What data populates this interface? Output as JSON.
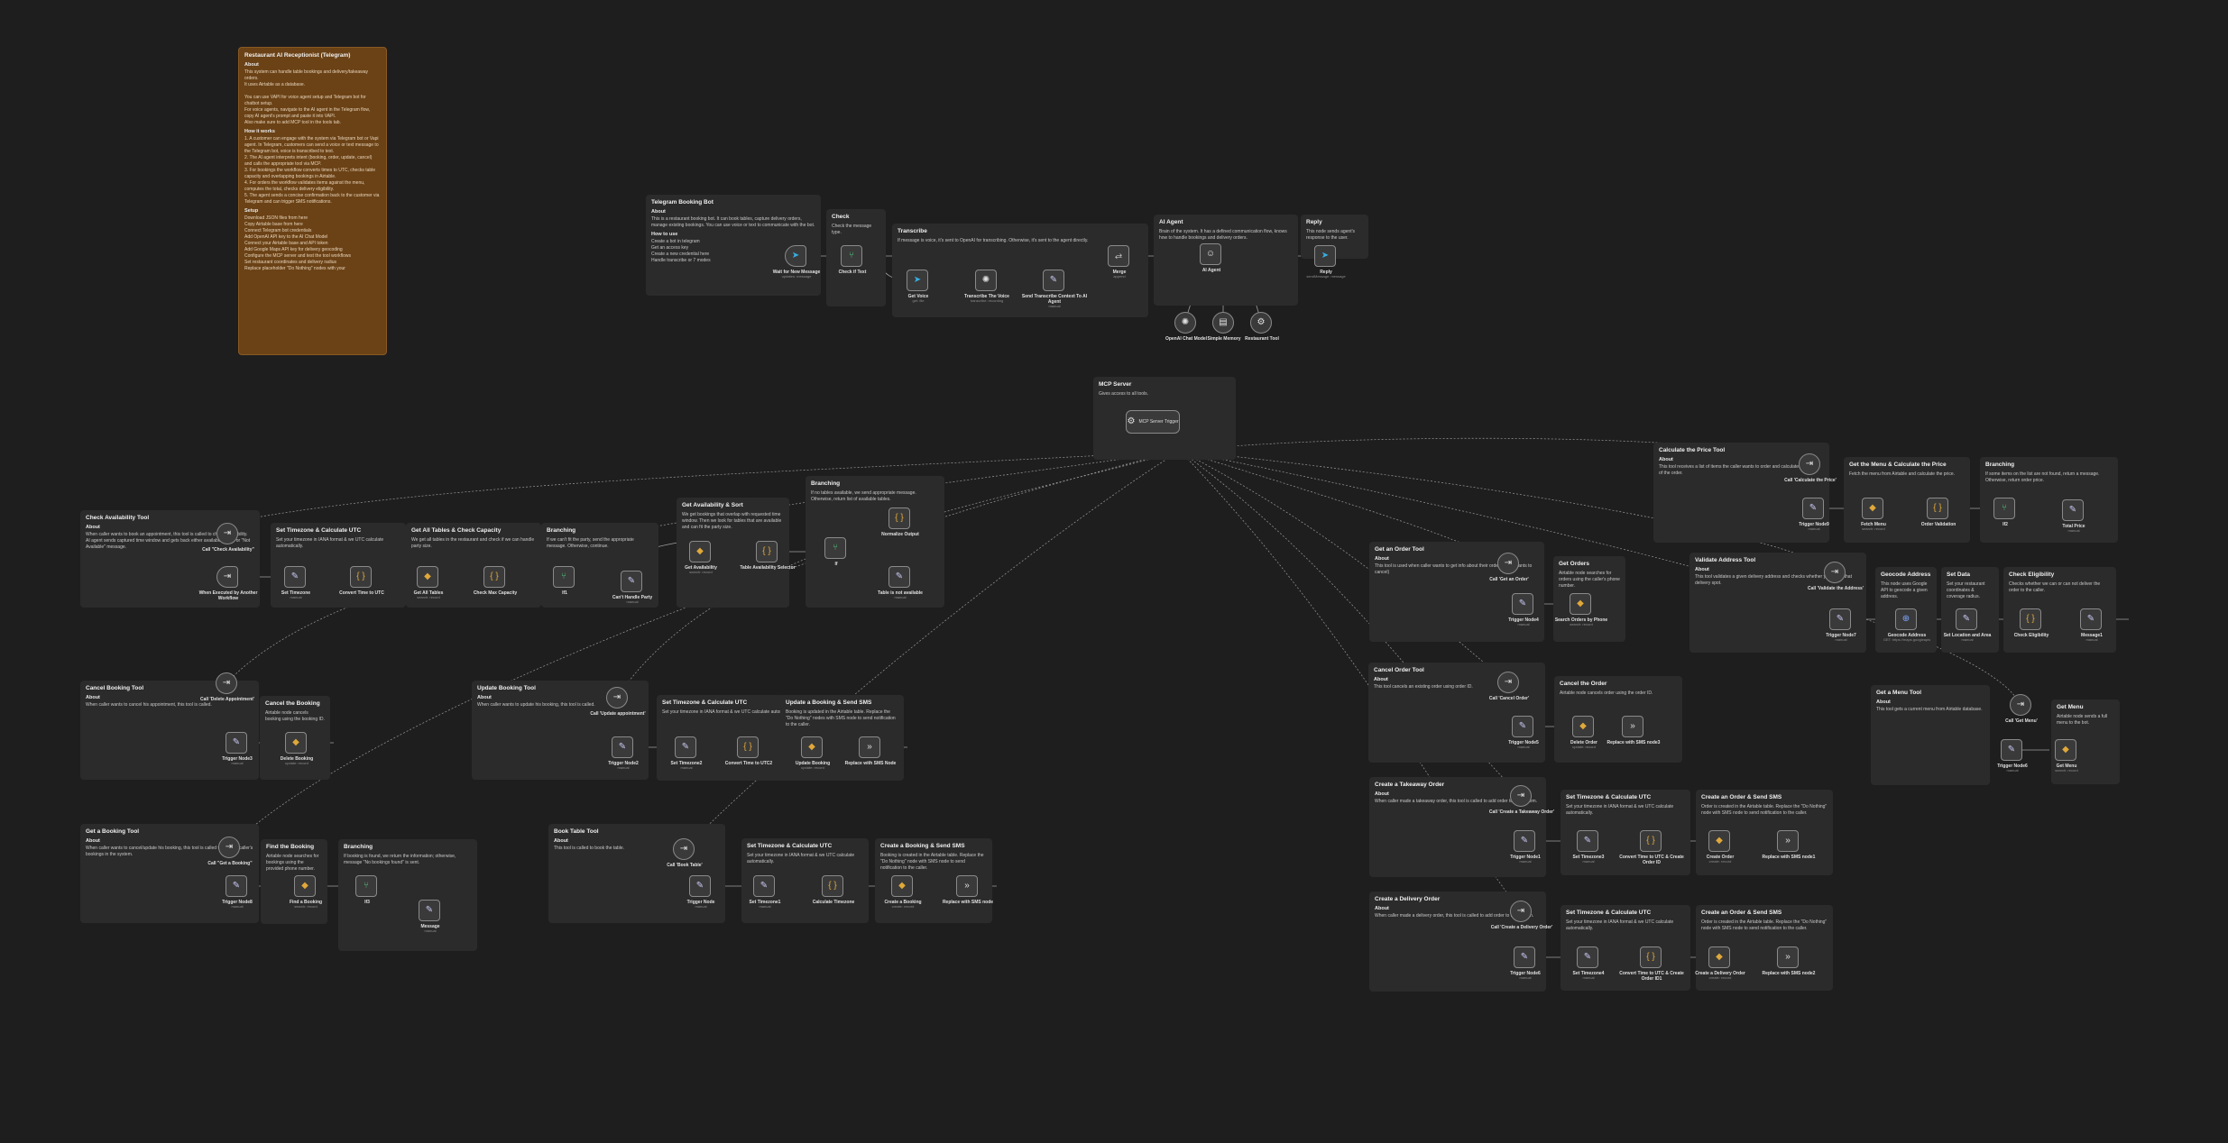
{
  "colors": {
    "canvas": "#1e1e1e",
    "sticky": "#2b2b2b",
    "sticky_intro": "#6b4216",
    "wire": "#9a9a9a",
    "accent": "#ff6d5a"
  },
  "intro": {
    "title": "Restaurant AI Receptionist (Telegram)",
    "about_h": "About",
    "about": "This system can handle table bookings and delivery/takeaway orders.\nIt uses Airtable as a database.\n\nYou can use VAPI for voice agent setup and Telegram bot for chatbot setup.\nFor voice agents, navigate to the AI agent in the Telegram flow, copy AI agent's prompt and paste it into VAPI.\nAlso make sure to add MCP tool in the tools tab.",
    "how_h": "How it works",
    "how": "1. A customer can engage with the system via Telegram bot or Vapi agent. In Telegram, customers can send a voice or text message to the Telegram bot, voice is transcribed to text.\n2. The AI agent interprets intent (booking, order, update, cancel) and calls the appropriate tool via MCP.\n3. For bookings the workflow converts times to UTC, checks table capacity and overlapping bookings in Airtable.\n4. For orders the workflow validates items against the menu, computes the total, checks delivery eligibility.\n5. The agent sends a concise confirmation back to the customer via Telegram and can trigger SMS notifications.",
    "setup_h": "Setup",
    "setup": "Download JSON files from here\nCopy Airtable base from here\nConnect Telegram bot credentials\nAdd OpenAI API key to the AI Chat Model\nConnect your Airtable base and API token\nAdd Google Maps API key for delivery geocoding\nConfigure the MCP server and test the tool workflows\nSet restaurant coordinates and delivery radius\nReplace placeholder \"Do Nothing\" nodes with your"
  },
  "sections": [
    {
      "title": "Telegram Booking Bot",
      "h": "About",
      "body": "This is a restaurant booking bot. It can book tables, capture delivery orders, manage existing bookings. You can use voice or text to communicate with the bot.",
      "h2": "How to use",
      "body2": "Create a bot in telegram\nGet an access key\nCreate a new credential here\nHandle transcribe or 7 modes"
    },
    {
      "title": "Check",
      "body": "Check the message type."
    },
    {
      "title": "Transcribe",
      "body": "If message is voice, it's sent to OpenAI for transcribing. Otherwise, it's sent to the agent directly."
    },
    {
      "title": "AI Agent",
      "body": "Brain of the system. It has a defined communication flow, knows how to handle bookings and delivery orders."
    },
    {
      "title": "Reply",
      "body": "This node sends agent's response to the user."
    },
    {
      "title": "MCP Server",
      "body": "Gives access to all tools."
    },
    {
      "title": "Check Availability Tool",
      "h": "About",
      "body": "When caller wants to book an appointment, this tool is called to check availability.\nAI agent sends captured time window and gets back either available tables or \"Not Available\" message."
    },
    {
      "title": "Set Timezone & Calculate UTC",
      "body": "Set your timezone in IANA format & we UTC calculate automatically."
    },
    {
      "title": "Get All Tables & Check Capacity",
      "body": "We get all tables in the restaurant and check if we can handle party size."
    },
    {
      "title": "Branching",
      "body": "If we can't fit the party, send the appropriate message. Otherwise, continue."
    },
    {
      "title": "Get Availability & Sort",
      "body": "We get bookings that overlap with requested time window. Then we look for tables that are available and can fit the party size."
    },
    {
      "title": "Branching",
      "body": "If no tables available, we send appropriate message. Otherwise, return list of available tables."
    },
    {
      "title": "Calculate the Price Tool",
      "h": "About",
      "body": "This tool receives a list of items the caller wants to order and calculates the price of the order."
    },
    {
      "title": "Get the Menu & Calculate the Price",
      "body": "Fetch the menu from Airtable and calculate the price."
    },
    {
      "title": "Branching",
      "body": "If some items on the list are not found, return a message. Otherwise, return order price."
    },
    {
      "title": "Get an Order Tool",
      "h": "About",
      "body": "This tool is used when caller wants to get info about their order (eg he wants to cancel)"
    },
    {
      "title": "Get Orders",
      "body": "Airtable node searches for orders using the caller's phone number."
    },
    {
      "title": "Validate Address Tool",
      "h": "About",
      "body": "This tool validates a given delivery address and checks whether you cover that delivery spot."
    },
    {
      "title": "Geocode Address",
      "body": "This node uses Google API to geocode a given address."
    },
    {
      "title": "Set Data",
      "body": "Set your restaurant coordinates & coverage radius."
    },
    {
      "title": "Check Eligibility",
      "body": "Checks whether we can or can not deliver the order to the caller."
    },
    {
      "title": "Cancel Booking Tool",
      "h": "About",
      "body": "When caller wants to cancel his appointment, this tool is called."
    },
    {
      "title": "Cancel the Booking",
      "body": "Airtable node cancels booking using the booking ID."
    },
    {
      "title": "Update Booking Tool",
      "h": "About",
      "body": "When caller wants to update his booking, this tool is called."
    },
    {
      "title": "Set Timezone & Calculate UTC",
      "body": "Set your timezone in IANA format & we UTC calculate automatically."
    },
    {
      "title": "Update a Booking & Send SMS",
      "body": "Booking is updated in the Airtable table. Replace the \"Do Nothing\" nodes with SMS node to send notification to the caller."
    },
    {
      "title": "Cancel Order Tool",
      "h": "About",
      "body": "This tool cancels an existing order using order ID."
    },
    {
      "title": "Cancel the Order",
      "body": "Airtable node cancels order using the order ID."
    },
    {
      "title": "Get a Menu Tool",
      "h": "About",
      "body": "This tool gets a current menu from Airtable database."
    },
    {
      "title": "Get Menu",
      "body": "Airtable node sends a full menu to the bot."
    },
    {
      "title": "Create a Takeaway Order",
      "h": "About",
      "body": "When caller made a takeaway order, this tool is called to add order to the system."
    },
    {
      "title": "Set Timezone & Calculate UTC",
      "body": "Set your timezone in IANA format & we UTC calculate automatically."
    },
    {
      "title": "Create an Order & Send SMS",
      "body": "Order is created in the Airtable table. Replace the \"Do Nothing\" node with SMS node to send notification to the caller."
    },
    {
      "title": "Get a Booking Tool",
      "h": "About",
      "body": "When caller wants to cancel/update his booking, this tool is called to find the caller's bookings in the system."
    },
    {
      "title": "Find the Booking",
      "body": "Airtable node searches for bookings using the provided phone number."
    },
    {
      "title": "Branching",
      "body": "If booking is found, we return the information; otherwise, message \"No bookings found\" is sent."
    },
    {
      "title": "Book Table Tool",
      "h": "About",
      "body": "This tool is called to book the table."
    },
    {
      "title": "Set Timezone & Calculate UTC",
      "body": "Set your timezone in IANA format & we UTC calculate automatically."
    },
    {
      "title": "Create a Booking & Send SMS",
      "body": "Booking is created in the Airtable table. Replace the \"Do Nothing\" node with SMS node to send notification to the caller."
    },
    {
      "title": "Create a Delivery Order",
      "h": "About",
      "body": "When caller made a delivery order, this tool is called to add order to the system."
    },
    {
      "title": "Set Timezone & Calculate UTC",
      "body": "Set your timezone in IANA format & we UTC calculate automatically."
    },
    {
      "title": "Create an Order & Send SMS",
      "body": "Order is created in the Airtable table. Replace the \"Do Nothing\" node with SMS node to send notification to the caller."
    }
  ],
  "nodes": [
    {
      "name": "Wait for New Message",
      "sub": "updates: message",
      "icon": "telegram-icon",
      "glyph": "➤",
      "cls": "trig",
      "tone": "tg"
    },
    {
      "name": "Check if Text",
      "sub": "",
      "icon": "switch-icon",
      "glyph": "⑂",
      "tone": "green"
    },
    {
      "name": "Get Voice",
      "sub": "get: file",
      "icon": "telegram-icon",
      "glyph": "➤",
      "tone": "tg"
    },
    {
      "name": "Transcribe The Voice",
      "sub": "transcribe: recording",
      "icon": "openai-icon",
      "glyph": "✺",
      "tone": "white"
    },
    {
      "name": "Send Transcribe Context To AI Agent",
      "sub": "manual",
      "icon": "edit-icon",
      "glyph": "✎"
    },
    {
      "name": "Merge",
      "sub": "append",
      "icon": "merge-icon",
      "glyph": "⥄",
      "tone": "white"
    },
    {
      "name": "AI Agent",
      "sub": "",
      "icon": "robot-icon",
      "glyph": "☺",
      "tone": "white"
    },
    {
      "name": "OpenAI Chat Model",
      "sub": "",
      "icon": "openai-icon",
      "glyph": "✺",
      "cls": "tool",
      "tone": "white"
    },
    {
      "name": "Simple Memory",
      "sub": "",
      "icon": "memory-icon",
      "glyph": "▤",
      "cls": "tool",
      "tone": "white"
    },
    {
      "name": "Restaurant Tool",
      "sub": "",
      "icon": "mcp-icon",
      "glyph": "⚙",
      "cls": "tool",
      "tone": "white"
    },
    {
      "name": "Reply",
      "sub": "sendMessage: message",
      "icon": "telegram-icon",
      "glyph": "➤",
      "tone": "tg"
    },
    {
      "name": "MCP Server Trigger",
      "sub": "",
      "icon": "mcp-icon",
      "glyph": "⚙",
      "cls": "big",
      "tone": "white"
    },
    {
      "name": "Call \"Check Availability\"",
      "sub": "",
      "icon": "tool-call-icon",
      "glyph": "⇥",
      "cls": "tool",
      "tone": "white"
    },
    {
      "name": "When Executed by Another Workflow",
      "sub": "",
      "icon": "execute-trigger-icon",
      "glyph": "⇥",
      "cls": "trig",
      "tone": "white"
    },
    {
      "name": "Set Timezone",
      "sub": "manual",
      "icon": "edit-icon",
      "glyph": "✎"
    },
    {
      "name": "Convert Time to UTC",
      "sub": "",
      "icon": "code-icon",
      "glyph": "{ }",
      "tone": "amber"
    },
    {
      "name": "Get All Tables",
      "sub": "search: record",
      "icon": "airtable-icon",
      "glyph": "◆",
      "tone": "amber"
    },
    {
      "name": "Check Max Capacity",
      "sub": "",
      "icon": "code-icon",
      "glyph": "{ }",
      "tone": "amber"
    },
    {
      "name": "If1",
      "sub": "",
      "icon": "if-icon",
      "glyph": "⑂",
      "tone": "green"
    },
    {
      "name": "Can't Handle Party",
      "sub": "manual",
      "icon": "edit-icon",
      "glyph": "✎"
    },
    {
      "name": "Get Availability",
      "sub": "search: record",
      "icon": "airtable-icon",
      "glyph": "◆",
      "tone": "amber"
    },
    {
      "name": "Table Availability Selector",
      "sub": "",
      "icon": "code-icon",
      "glyph": "{ }",
      "tone": "amber"
    },
    {
      "name": "If",
      "sub": "",
      "icon": "if-icon",
      "glyph": "⑂",
      "tone": "green"
    },
    {
      "name": "Normalize Output",
      "sub": "",
      "icon": "code-icon",
      "glyph": "{ }",
      "tone": "amber"
    },
    {
      "name": "Table is not available",
      "sub": "manual",
      "icon": "edit-icon",
      "glyph": "✎"
    },
    {
      "name": "Call 'Calculate the Price'",
      "sub": "",
      "icon": "tool-call-icon",
      "glyph": "⇥",
      "cls": "tool",
      "tone": "white"
    },
    {
      "name": "Trigger Node9",
      "sub": "manual",
      "icon": "edit-icon",
      "glyph": "✎"
    },
    {
      "name": "Fetch Menu",
      "sub": "search: record",
      "icon": "airtable-icon",
      "glyph": "◆",
      "tone": "amber"
    },
    {
      "name": "Order Validation",
      "sub": "",
      "icon": "code-icon",
      "glyph": "{ }",
      "tone": "amber"
    },
    {
      "name": "If2",
      "sub": "",
      "icon": "if-icon",
      "glyph": "⑂",
      "tone": "green"
    },
    {
      "name": "Total Price",
      "sub": "manual",
      "icon": "edit-icon",
      "glyph": "✎"
    },
    {
      "name": "Call 'Get an Order'",
      "sub": "",
      "icon": "tool-call-icon",
      "glyph": "⇥",
      "cls": "tool",
      "tone": "white"
    },
    {
      "name": "Trigger Node4",
      "sub": "manual",
      "icon": "edit-icon",
      "glyph": "✎"
    },
    {
      "name": "Search Orders by Phone",
      "sub": "search: record",
      "icon": "airtable-icon",
      "glyph": "◆",
      "tone": "amber"
    },
    {
      "name": "Call 'Validate the Address'",
      "sub": "",
      "icon": "tool-call-icon",
      "glyph": "⇥",
      "cls": "tool",
      "tone": "white"
    },
    {
      "name": "Trigger Node7",
      "sub": "manual",
      "icon": "edit-icon",
      "glyph": "✎"
    },
    {
      "name": "Geocode Address",
      "sub": "GET: https://maps.googleapis",
      "icon": "globe-icon",
      "glyph": "⊕",
      "tone": "blue"
    },
    {
      "name": "Set Location and Area",
      "sub": "manual",
      "icon": "edit-icon",
      "glyph": "✎"
    },
    {
      "name": "Check Eligibility",
      "sub": "",
      "icon": "code-icon",
      "glyph": "{ }",
      "tone": "amber"
    },
    {
      "name": "Message1",
      "sub": "manual",
      "icon": "edit-icon",
      "glyph": "✎"
    },
    {
      "name": "Call 'Delete Appointment'",
      "sub": "",
      "icon": "tool-call-icon",
      "glyph": "⇥",
      "cls": "tool",
      "tone": "white"
    },
    {
      "name": "Trigger Node3",
      "sub": "manual",
      "icon": "edit-icon",
      "glyph": "✎"
    },
    {
      "name": "Delete Booking",
      "sub": "update: record",
      "icon": "airtable-icon",
      "glyph": "◆",
      "tone": "amber"
    },
    {
      "name": "Call 'Update appointment'",
      "sub": "",
      "icon": "tool-call-icon",
      "glyph": "⇥",
      "cls": "tool",
      "tone": "white"
    },
    {
      "name": "Trigger Node2",
      "sub": "manual",
      "icon": "edit-icon",
      "glyph": "✎"
    },
    {
      "name": "Set Timezone2",
      "sub": "manual",
      "icon": "edit-icon",
      "glyph": "✎"
    },
    {
      "name": "Convert Time to UTC2",
      "sub": "",
      "icon": "code-icon",
      "glyph": "{ }",
      "tone": "amber"
    },
    {
      "name": "Update Booking",
      "sub": "update: record",
      "icon": "airtable-icon",
      "glyph": "◆",
      "tone": "amber"
    },
    {
      "name": "Replace with SMS Node",
      "sub": "",
      "icon": "noop-icon",
      "glyph": "»",
      "tone": "white"
    },
    {
      "name": "Call 'Cancel Order'",
      "sub": "",
      "icon": "tool-call-icon",
      "glyph": "⇥",
      "cls": "tool",
      "tone": "white"
    },
    {
      "name": "Trigger Node5",
      "sub": "manual",
      "icon": "edit-icon",
      "glyph": "✎"
    },
    {
      "name": "Delete Order",
      "sub": "update: record",
      "icon": "airtable-icon",
      "glyph": "◆",
      "tone": "amber"
    },
    {
      "name": "Replace with SMS node3",
      "sub": "",
      "icon": "noop-icon",
      "glyph": "»",
      "tone": "white"
    },
    {
      "name": "Call 'Get Menu'",
      "sub": "",
      "icon": "tool-call-icon",
      "glyph": "⇥",
      "cls": "tool",
      "tone": "white"
    },
    {
      "name": "Trigger Node6",
      "sub": "manual",
      "icon": "edit-icon",
      "glyph": "✎"
    },
    {
      "name": "Get Menu",
      "sub": "search: record",
      "icon": "airtable-icon",
      "glyph": "◆",
      "tone": "amber"
    },
    {
      "name": "Call 'Create a Takeaway Order'",
      "sub": "",
      "icon": "tool-call-icon",
      "glyph": "⇥",
      "cls": "tool",
      "tone": "white"
    },
    {
      "name": "Trigger Node1",
      "sub": "manual",
      "icon": "edit-icon",
      "glyph": "✎"
    },
    {
      "name": "Set Timezone3",
      "sub": "manual",
      "icon": "edit-icon",
      "glyph": "✎"
    },
    {
      "name": "Convert Time to UTC & Create Order ID",
      "sub": "",
      "icon": "code-icon",
      "glyph": "{ }",
      "tone": "amber"
    },
    {
      "name": "Create Order",
      "sub": "create: record",
      "icon": "airtable-icon",
      "glyph": "◆",
      "tone": "amber"
    },
    {
      "name": "Replace with SMS node1",
      "sub": "",
      "icon": "noop-icon",
      "glyph": "»",
      "tone": "white"
    },
    {
      "name": "Call \"Get a Booking\"",
      "sub": "",
      "icon": "tool-call-icon",
      "glyph": "⇥",
      "cls": "tool",
      "tone": "white"
    },
    {
      "name": "Trigger Node8",
      "sub": "manual",
      "icon": "edit-icon",
      "glyph": "✎"
    },
    {
      "name": "Find a Booking",
      "sub": "search: record",
      "icon": "airtable-icon",
      "glyph": "◆",
      "tone": "amber"
    },
    {
      "name": "If3",
      "sub": "",
      "icon": "if-icon",
      "glyph": "⑂",
      "tone": "green"
    },
    {
      "name": "Message",
      "sub": "manual",
      "icon": "edit-icon",
      "glyph": "✎"
    },
    {
      "name": "Call 'Book Table'",
      "sub": "",
      "icon": "tool-call-icon",
      "glyph": "⇥",
      "cls": "tool",
      "tone": "white"
    },
    {
      "name": "Trigger Node",
      "sub": "manual",
      "icon": "edit-icon",
      "glyph": "✎"
    },
    {
      "name": "Set Timezone1",
      "sub": "manual",
      "icon": "edit-icon",
      "glyph": "✎"
    },
    {
      "name": "Calculate Timezone",
      "sub": "",
      "icon": "code-icon",
      "glyph": "{ }",
      "tone": "amber"
    },
    {
      "name": "Create a Booking",
      "sub": "create: record",
      "icon": "airtable-icon",
      "glyph": "◆",
      "tone": "amber"
    },
    {
      "name": "Replace with SMS node",
      "sub": "",
      "icon": "noop-icon",
      "glyph": "»",
      "tone": "white"
    },
    {
      "name": "Call 'Create a Delivery Order'",
      "sub": "",
      "icon": "tool-call-icon",
      "glyph": "⇥",
      "cls": "tool",
      "tone": "white"
    },
    {
      "name": "Trigger Node6",
      "sub": "manual",
      "icon": "edit-icon",
      "glyph": "✎"
    },
    {
      "name": "Set Timezone4",
      "sub": "manual",
      "icon": "edit-icon",
      "glyph": "✎"
    },
    {
      "name": "Convert Time to UTC & Create Order ID1",
      "sub": "",
      "icon": "code-icon",
      "glyph": "{ }",
      "tone": "amber"
    },
    {
      "name": "Create a Delivery Order",
      "sub": "create: record",
      "icon": "airtable-icon",
      "glyph": "◆",
      "tone": "amber"
    },
    {
      "name": "Replace with SMS node2",
      "sub": "",
      "icon": "noop-icon",
      "glyph": "»",
      "tone": "white"
    }
  ]
}
